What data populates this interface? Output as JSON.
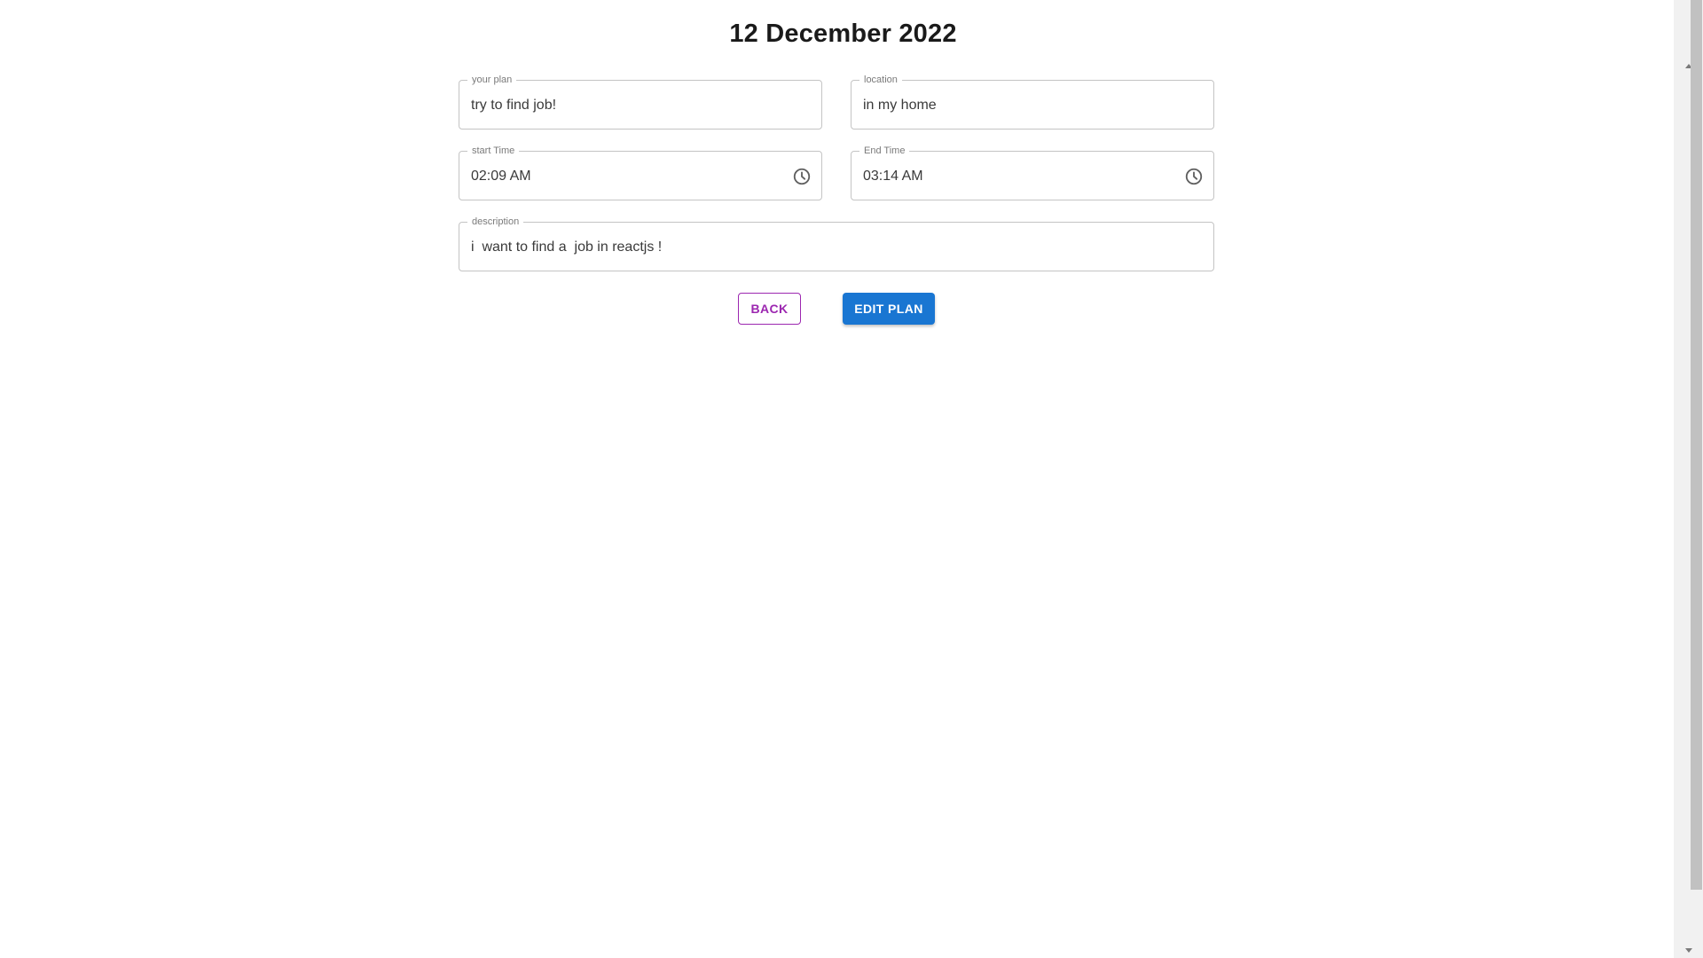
{
  "header": {
    "title": "12 December 2022"
  },
  "form": {
    "plan": {
      "label": "your plan",
      "value": "try to find job!"
    },
    "location": {
      "label": "location",
      "value": "in my home"
    },
    "start_time": {
      "label": "start Time",
      "value": "02:09 AM",
      "icon": "clock-icon"
    },
    "end_time": {
      "label": "End Time",
      "value": "03:14 AM",
      "icon": "clock-icon"
    },
    "description": {
      "label": "description",
      "value": "i  want to find a  job in reactjs !"
    }
  },
  "actions": {
    "back_label": "BACK",
    "edit_label": "EDIT PLAN",
    "back_color": "#9c27b0",
    "edit_color": "#1976d2"
  }
}
